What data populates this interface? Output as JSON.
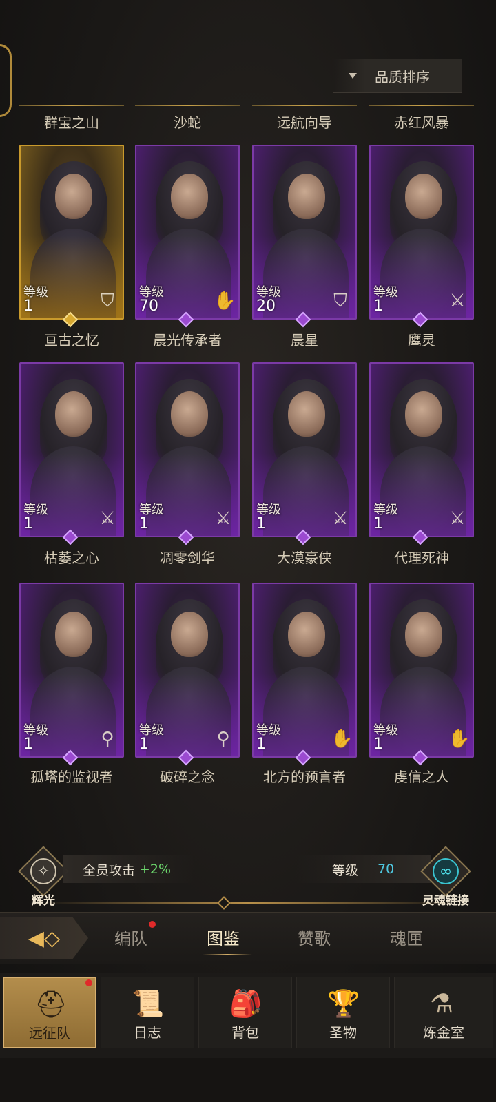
{
  "sort": {
    "label": "品质排序"
  },
  "top_names": [
    "群宝之山",
    "沙蛇",
    "远航向导",
    "赤红风暴"
  ],
  "rows": [
    [
      {
        "level_label": "等级",
        "level": "1",
        "name": "亘古之忆",
        "rarity": "gold",
        "class_icon": "shield-icon",
        "glyph": "⛉"
      },
      {
        "level_label": "等级",
        "level": "70",
        "name": "晨光传承者",
        "rarity": "purple",
        "class_icon": "hand-icon",
        "glyph": "✋"
      },
      {
        "level_label": "等级",
        "level": "20",
        "name": "晨星",
        "rarity": "purple",
        "class_icon": "shield-icon",
        "glyph": "⛉"
      },
      {
        "level_label": "等级",
        "level": "1",
        "name": "鹰灵",
        "rarity": "purple",
        "class_icon": "sword-icon",
        "glyph": "⚔"
      }
    ],
    [
      {
        "level_label": "等级",
        "level": "1",
        "name": "枯萎之心",
        "rarity": "purple",
        "class_icon": "sword-icon",
        "glyph": "⚔"
      },
      {
        "level_label": "等级",
        "level": "1",
        "name": "凋零剑华",
        "rarity": "purple",
        "class_icon": "sword-icon",
        "glyph": "⚔"
      },
      {
        "level_label": "等级",
        "level": "1",
        "name": "大漠豪侠",
        "rarity": "purple",
        "class_icon": "sword-icon",
        "glyph": "⚔"
      },
      {
        "level_label": "等级",
        "level": "1",
        "name": "代理死神",
        "rarity": "purple",
        "class_icon": "sword-icon",
        "glyph": "⚔"
      }
    ],
    [
      {
        "level_label": "等级",
        "level": "1",
        "name": "孤塔的监视者",
        "rarity": "purple",
        "class_icon": "staff-icon",
        "glyph": "⚲"
      },
      {
        "level_label": "等级",
        "level": "1",
        "name": "破碎之念",
        "rarity": "purple",
        "class_icon": "staff-icon",
        "glyph": "⚲"
      },
      {
        "level_label": "等级",
        "level": "1",
        "name": "北方的预言者",
        "rarity": "purple",
        "class_icon": "hand-icon",
        "glyph": "✋"
      },
      {
        "level_label": "等级",
        "level": "1",
        "name": "虔信之人",
        "rarity": "purple",
        "class_icon": "hand-icon",
        "glyph": "✋"
      }
    ]
  ],
  "status": {
    "left_caption": "辉光",
    "attack_label": "全员攻击",
    "attack_value": "+2%",
    "level_label": "等级",
    "level_value": "70",
    "right_caption": "灵魂链接"
  },
  "subtabs": [
    {
      "label": "编队",
      "badge": true
    },
    {
      "label": "图鉴",
      "active": true
    },
    {
      "label": "赞歌"
    },
    {
      "label": "魂匣"
    }
  ],
  "nav": [
    {
      "label": "远征队",
      "icon": "helmet-icon",
      "glyph": "⛑",
      "active": true,
      "badge": true
    },
    {
      "label": "日志",
      "icon": "scroll-icon",
      "glyph": "📜"
    },
    {
      "label": "背包",
      "icon": "backpack-icon",
      "glyph": "🎒"
    },
    {
      "label": "圣物",
      "icon": "chalice-icon",
      "glyph": "🏆"
    },
    {
      "label": "炼金室",
      "icon": "alchemy-icon",
      "glyph": "⚗"
    }
  ],
  "colors": {
    "purple_border": "#7b3aa6",
    "gold_border": "#c99a2c",
    "attack_green": "#6bd46b",
    "level_blue": "#4fc8e0",
    "badge_red": "#e02a2a"
  }
}
